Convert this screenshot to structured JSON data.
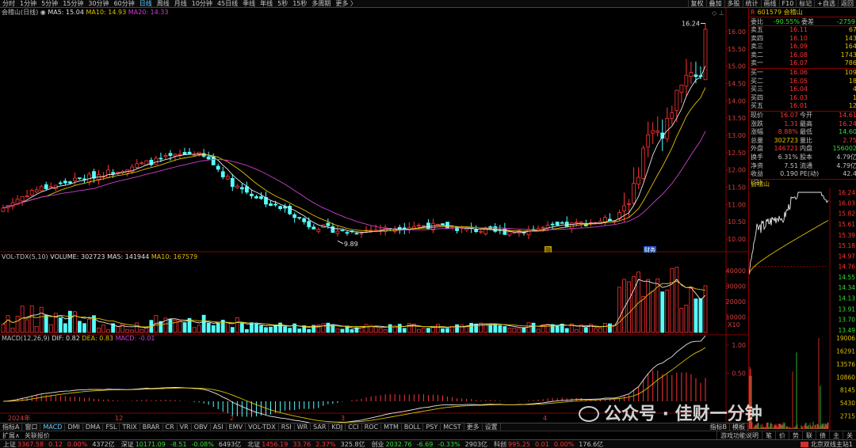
{
  "toolbar": {
    "periods": [
      "分时",
      "1分钟",
      "5分钟",
      "15分钟",
      "30分钟",
      "60分钟",
      "日线",
      "周线",
      "月线",
      "10分钟",
      "45日线",
      "季线",
      "年线",
      "5秒",
      "15秒",
      "多周期",
      "更多 〉"
    ],
    "active_period": "日线",
    "right_items": [
      "复权",
      "叠加",
      "多股",
      "统计",
      "画线",
      "F10",
      "标记",
      "+自选",
      "返回"
    ]
  },
  "main_chart": {
    "title": "会稽山(日线)",
    "ma5_label": "MA5: 15.04",
    "ma10_label": "MA10: 14.93",
    "ma20_label": "MA20: 14.33",
    "high_marker": "16.24",
    "low_marker": "9.89",
    "event_tags": [
      "融",
      "财务"
    ],
    "y_ticks": [
      "16.00",
      "15.50",
      "15.00",
      "14.50",
      "14.00",
      "13.50",
      "13.00",
      "12.50",
      "12.00",
      "11.50",
      "11.00",
      "10.50",
      "10.00"
    ]
  },
  "vol_chart": {
    "title": "VOL-TDX(5,10)",
    "volume_label": "VOLUME: 302723",
    "ma5_label": "MA5: 141944",
    "ma10_label": "MA10: 167579",
    "y_ticks": [
      "40000",
      "30000",
      "20000",
      "10000"
    ],
    "unit": "X10"
  },
  "macd_chart": {
    "title": "MACD(12,26,9)",
    "dif_label": "DIF: 0.82",
    "dea_label": "DEA: 0.83",
    "macd_label": "MACD: -0.01",
    "y_ticks": [
      "1.00",
      "0.50"
    ]
  },
  "x_axis": {
    "labels": [
      "2024年",
      "12",
      "2",
      "3",
      "4"
    ]
  },
  "quote": {
    "code_name": "601579 会稽山",
    "webi_label": "委比",
    "webi_value": "-90.55%",
    "weicha_label": "委差",
    "weicha_value": "-2759",
    "asks": [
      {
        "label": "卖五",
        "price": "16.11",
        "vol": "67"
      },
      {
        "label": "卖四",
        "price": "16.10",
        "vol": "143"
      },
      {
        "label": "卖三",
        "price": "16.09",
        "vol": "164"
      },
      {
        "label": "卖二",
        "price": "16.08",
        "vol": "1743"
      },
      {
        "label": "卖一",
        "price": "16.07",
        "vol": "786"
      }
    ],
    "bids": [
      {
        "label": "买一",
        "price": "16.06",
        "vol": "109"
      },
      {
        "label": "买二",
        "price": "16.05",
        "vol": "18"
      },
      {
        "label": "买三",
        "price": "16.04",
        "vol": "4"
      },
      {
        "label": "买四",
        "price": "16.03",
        "vol": "1"
      },
      {
        "label": "买五",
        "price": "16.01",
        "vol": "12"
      }
    ],
    "stats": [
      {
        "l1": "现价",
        "v1": "16.07",
        "c1": "#ff3333",
        "l2": "今开",
        "v2": "14.61",
        "c2": "#ff3333"
      },
      {
        "l1": "涨跌",
        "v1": "1.31",
        "c1": "#ff3333",
        "l2": "最高",
        "v2": "16.24",
        "c2": "#ff3333"
      },
      {
        "l1": "涨幅",
        "v1": "8.88%",
        "c1": "#ff3333",
        "l2": "最低",
        "v2": "14.60",
        "c2": "#33dd33"
      },
      {
        "l1": "总量",
        "v1": "302723",
        "c1": "#e0c000",
        "l2": "量比",
        "v2": "2.75",
        "c2": "#ff3333"
      },
      {
        "l1": "外盘",
        "v1": "146721",
        "c1": "#ff3333",
        "l2": "内盘",
        "v2": "156002",
        "c2": "#33dd33"
      },
      {
        "l1": "换手",
        "v1": "6.31%",
        "c1": "#c0c0c0",
        "l2": "股本",
        "v2": "4.79亿",
        "c2": "#c0c0c0"
      },
      {
        "l1": "净资",
        "v1": "7.51",
        "c1": "#c0c0c0",
        "l2": "流通",
        "v2": "4.79亿",
        "c2": "#c0c0c0"
      },
      {
        "l1": "收益(三)",
        "v1": "0.190",
        "c1": "#c0c0c0",
        "l2": "PE(动)",
        "v2": "42.4",
        "c2": "#c0c0c0"
      }
    ],
    "mini_title": "会稽山",
    "mini_right_ticks": [
      "16.24",
      "16.03",
      "15.82",
      "15.61",
      "15.39",
      "15.18",
      "14.97",
      "14.76",
      "14.55",
      "14.34",
      "14.13",
      "13.91",
      "13.70",
      "13.49"
    ],
    "mini_vol_ticks": [
      "19006",
      "16291",
      "13576",
      "10860",
      "8145",
      "5430",
      "2715"
    ]
  },
  "bottom_tabs": [
    "指标A",
    "窗口",
    "MACD",
    "DMI",
    "DMA",
    "FSL",
    "TRIX",
    "BRAR",
    "CR",
    "VR",
    "OBV",
    "ASI",
    "EMV",
    "VOL-TDX",
    "RSI",
    "WR",
    "SAR",
    "KDJ",
    "CCI",
    "ROC",
    "MTM",
    "BOLL",
    "PSY",
    "MCST",
    "更多",
    "设置"
  ],
  "bottom_tab_active": "MACD",
  "right_tabs": [
    "指标B",
    "模板"
  ],
  "row2": {
    "left": [
      "扩展∧",
      "关联报价"
    ],
    "right": [
      "游戏功能说明",
      "笔",
      "价",
      "势",
      "联",
      "债",
      "主",
      "关"
    ]
  },
  "status": {
    "sh": {
      "name": "上证",
      "v": "3367.58",
      "c": "0.12",
      "p": "0.00%",
      "amt": "4372亿"
    },
    "sz": {
      "name": "深证",
      "v": "10171.09",
      "c": "-8.51",
      "p": "-0.08%",
      "amt": "6493亿"
    },
    "bz": {
      "name": "北证",
      "v": "1456.19",
      "c": "33.76",
      "p": "2.37%",
      "amt": "325.8亿"
    },
    "cy": {
      "name": "创业",
      "v": "2032.76",
      "c": "-6.69",
      "p": "-0.33%",
      "amt": "2903亿"
    },
    "kc": {
      "name": "科创",
      "v": "995.25",
      "c": "0.01",
      "p": "0.00%",
      "amt": "176.6亿"
    },
    "site": "北京双线主站1"
  },
  "watermark": "公众号 · 佳财一分钟"
}
